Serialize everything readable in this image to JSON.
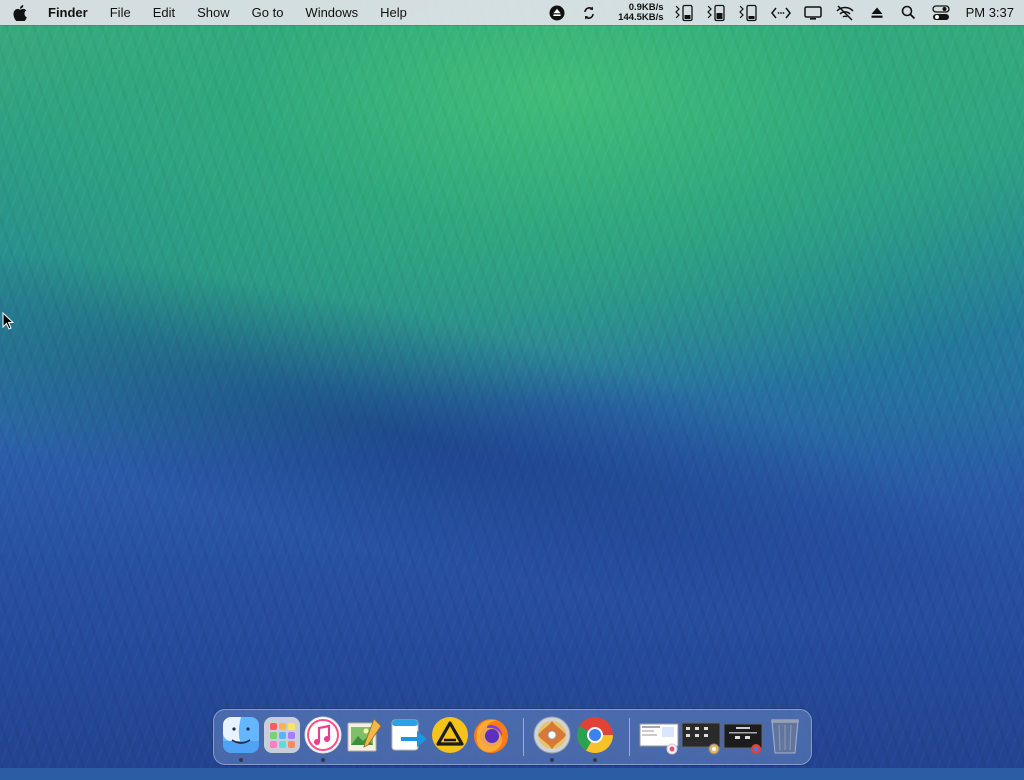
{
  "menubar": {
    "app_name": "Finder",
    "menus": [
      "File",
      "Edit",
      "Show",
      "Go to",
      "Windows",
      "Help"
    ],
    "net_upload": "0.9KB/s",
    "net_download": "144.5KB/s",
    "clock": "PM 3:37"
  },
  "status_icons": [
    "eject-circle-icon",
    "sync-icon",
    "battery-icon-1",
    "battery-icon-2",
    "battery-icon-3",
    "code-icon",
    "display-icon",
    "wifi-off-icon",
    "eject-icon",
    "search-icon",
    "control-center-icon"
  ],
  "dock": {
    "apps": [
      "finder-icon",
      "launchpad-icon",
      "music-icon",
      "preview-icon",
      "migration-icon",
      "altserver-icon",
      "firefox-icon",
      "dvd-player-icon",
      "chrome-icon"
    ],
    "running": [
      "finder-icon",
      "music-icon",
      "dvd-player-icon",
      "chrome-icon"
    ],
    "recent": [
      "screenshot-thumb-1",
      "screenshot-thumb-2",
      "screenshot-thumb-3"
    ],
    "trash": "trash-icon"
  },
  "colors": {
    "menubar_bg": "#e0e2e8",
    "wave_green": "#3faa7a",
    "ocean_blue": "#234391"
  }
}
